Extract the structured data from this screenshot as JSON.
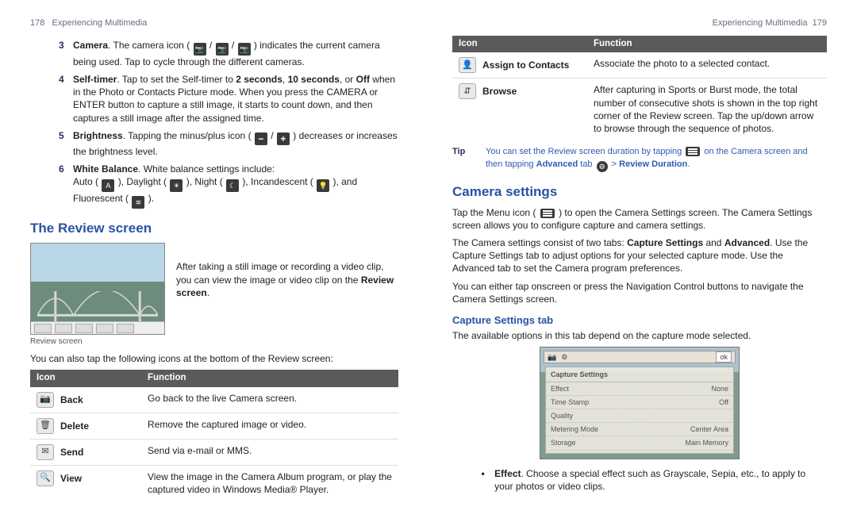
{
  "left_head": {
    "page": "178",
    "title": "Experiencing Multimedia"
  },
  "right_head": {
    "title": "Experiencing Multimedia",
    "page": "179"
  },
  "item3": {
    "num": "3",
    "lead": "Camera",
    "rest1": ". The camera icon ( ",
    "rest2": " / ",
    "rest3": " / ",
    "rest4": " ) indicates the current camera being used. Tap to cycle through the different cameras."
  },
  "item4": {
    "num": "4",
    "lead": "Self-timer",
    "rest_a": ". Tap to set the Self-timer to ",
    "b1": "2 seconds",
    "comma1": ", ",
    "b2": "10 seconds",
    "comma2": ", or ",
    "b3": "Off",
    "rest_b": " when in the Photo or Contacts Picture mode. When you press the CAMERA or ENTER button to capture a still image, it starts to count down, and then captures a still image after the assigned time."
  },
  "item5": {
    "num": "5",
    "lead": "Brightness",
    "rest_a": ". Tapping the minus/plus icon ( ",
    "sep": " / ",
    "rest_b": " ) decreases or increases the brightness level."
  },
  "item6": {
    "num": "6",
    "lead": "White Balance",
    "rest_a": ". White balance settings include:",
    "line2a": "Auto ( ",
    "line2b": " ), Daylight ( ",
    "line2c": " ), Night ( ",
    "line2d": " ), Incandescent ( ",
    "line2e": " ), and Fluorescent ( ",
    "line2f": " )."
  },
  "review_heading": "The Review screen",
  "review_para_a": "After taking a still image or recording a video clip, you can view the image or video clip on the ",
  "review_para_b_bold": "Review screen",
  "review_para_c": ".",
  "review_caption": "Review screen",
  "review_follow": "You can also tap the following icons at the bottom of the Review screen:",
  "table_headers": {
    "icon": "Icon",
    "func": "Function"
  },
  "left_table": [
    {
      "glyph": "📷",
      "label": "Back",
      "func": "Go back to the live Camera screen."
    },
    {
      "glyph": "🗑",
      "label": "Delete",
      "func": "Remove the captured image or video."
    },
    {
      "glyph": "✉",
      "label": "Send",
      "func": "Send via e-mail or MMS."
    },
    {
      "glyph": "🔍",
      "label": "View",
      "func": "View the image in the Camera Album program, or play the captured video in Windows Media® Player."
    }
  ],
  "right_table": [
    {
      "glyph": "👤",
      "label": "Assign to Contacts",
      "func": "Associate the photo to a selected contact."
    },
    {
      "glyph": "⇵",
      "label": "Browse",
      "func": "After capturing in Sports or Burst mode, the total number of consecutive shots is shown in the top right corner of the Review screen. Tap the up/down arrow to browse through the sequence of photos."
    }
  ],
  "tip": {
    "label": "Tip",
    "a": "You can set the Review screen duration by tapping ",
    "b": " on the Camera screen and then tapping ",
    "c_bold": "Advanced",
    "d": " tab ",
    "e": " > ",
    "f_bold": "Review Duration",
    "g": "."
  },
  "cam_settings_heading": "Camera settings",
  "cam_para1_a": "Tap the Menu icon ( ",
  "cam_para1_b": " ) to open the Camera Settings screen. The Camera Settings screen allows you to configure capture and camera settings.",
  "cam_para2_a": "The Camera settings consist of two tabs: ",
  "cam_para2_b_bold": "Capture Settings",
  "cam_para2_c": " and ",
  "cam_para2_d_bold": "Advanced",
  "cam_para2_e": ". Use the Capture Settings tab to adjust options for your selected capture mode. Use the Advanced tab to set the Camera program preferences.",
  "cam_para3": "You can either tap onscreen or press the Navigation Control buttons to navigate the Camera Settings screen.",
  "capture_tab_heading": "Capture Settings tab",
  "capture_tab_para": "The available options in this tab depend on the capture mode selected.",
  "settings_shot": {
    "top_left_glyph": "📷",
    "top_right": "ok",
    "panel_title": "Capture Settings",
    "rows": [
      {
        "k": "Effect",
        "v": "None"
      },
      {
        "k": "Time Stamp",
        "v": "Off"
      },
      {
        "k": "Quality",
        "v": ""
      },
      {
        "k": "Metering Mode",
        "v": "Center Area"
      },
      {
        "k": "Storage",
        "v": "Main Memory"
      }
    ]
  },
  "effect_bullet_a_bold": "Effect",
  "effect_bullet_b": ". Choose a special effect such as Grayscale, Sepia, etc., to apply to your photos or video clips."
}
